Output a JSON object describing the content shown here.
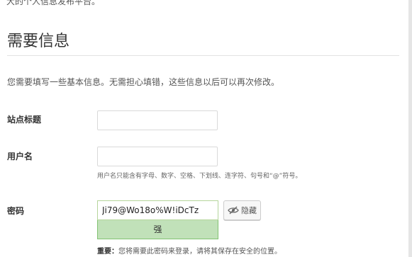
{
  "header": {
    "top_text": "大的个人信息发布平台。",
    "title": "需要信息",
    "intro": "您需要填写一些基本信息。无需担心填错，这些信息以后可以再次修改。"
  },
  "form": {
    "site_title": {
      "label": "站点标题",
      "value": ""
    },
    "username": {
      "label": "用户名",
      "value": "",
      "hint": "用户名只能含有字母、数字、空格、下划线、连字符、句号和“@”符号。"
    },
    "password": {
      "label": "密码",
      "value": "Ji79@Wo18o%W!iDcTz",
      "strength": "强",
      "hide_label": "隐藏",
      "notice_strong": "重要：",
      "notice": "您将需要此密码来登录，请将其保存在安全的位置。"
    }
  },
  "icons": {
    "hide_button_icon": "eye-slash-icon"
  },
  "colors": {
    "strength_bg": "#c1e1b9",
    "strength_border": "#83c373",
    "divider": "#e3e3e3"
  }
}
